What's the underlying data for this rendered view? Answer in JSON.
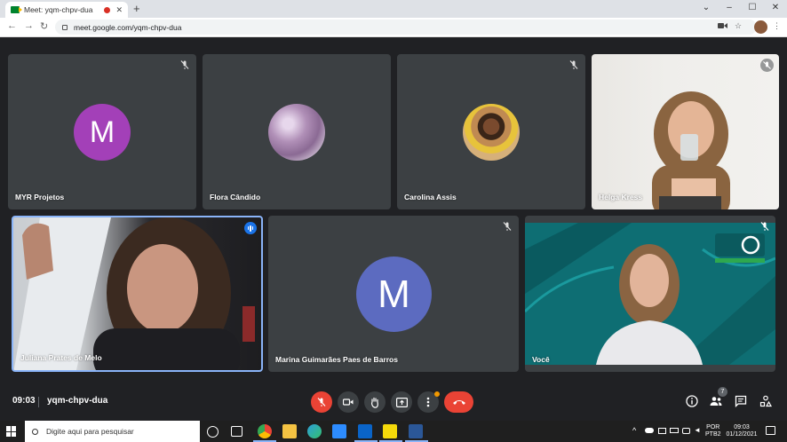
{
  "browser": {
    "tab_title": "Meet: yqm-chpv-dua",
    "tab_close": "✕",
    "new_tab": "+",
    "url": "meet.google.com/yqm-chpv-dua",
    "window_controls": [
      "⌄",
      "–",
      "☐",
      "✕"
    ]
  },
  "colors": {
    "tile_bg": "#3c4043",
    "page_bg": "#202124",
    "avatar_purple": "#a340b8",
    "avatar_indigo": "#5c6bc0",
    "red": "#ea4335",
    "active_blue": "#8ab4f8"
  },
  "participants": [
    {
      "name": "MYR Projetos",
      "initial": "M",
      "muted": true
    },
    {
      "name": "Flora Cândido",
      "muted": false
    },
    {
      "name": "Carolina Assis",
      "muted": true
    },
    {
      "name": "Helga Kress",
      "muted": true
    },
    {
      "name": "Juliana Prates de Melo",
      "muted": false,
      "speaking": true
    },
    {
      "name": "Marina Guimarães Paes de Barros",
      "initial": "M",
      "muted": true
    },
    {
      "name": "Você",
      "muted": true
    }
  ],
  "meeting": {
    "time": "09:03",
    "code": "yqm-chpv-dua",
    "people_count": "7"
  },
  "taskbar": {
    "search_placeholder": "Digite aqui para pesquisar",
    "lang": "POR",
    "layout": "PTB2",
    "clock_time": "09:03",
    "clock_date": "01/12/2021"
  }
}
